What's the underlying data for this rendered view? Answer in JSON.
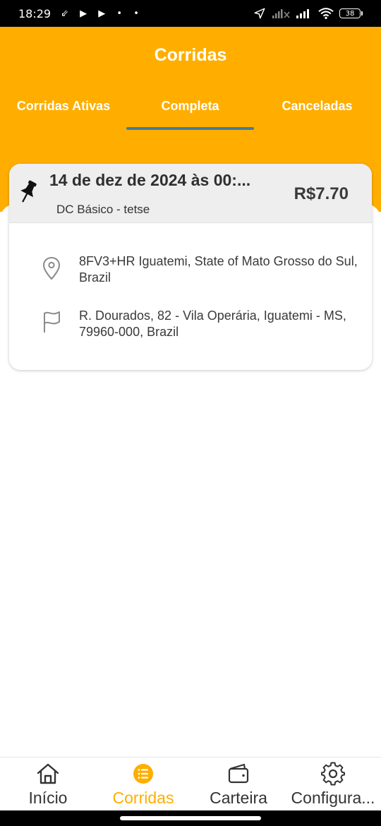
{
  "status_bar": {
    "time": "18:29",
    "left_glyphs": "⇙ ▶ ▶ • •",
    "battery_level": "38"
  },
  "header": {
    "title": "Corridas",
    "background_color": "#FFAE00",
    "tabs": [
      {
        "label": "Corridas Ativas",
        "active": false
      },
      {
        "label": "Completa",
        "active": true
      },
      {
        "label": "Canceladas",
        "active": false
      }
    ],
    "indicator_color": "#3F7DA6"
  },
  "ride": {
    "date": "14 de dez de 2024 às 00:...",
    "service": "DC Básico - tetse",
    "price": "R$7.70",
    "icon": "pushpin-icon",
    "pickup_icon": "location-pin-icon",
    "pickup_address": "8FV3+HR Iguatemi, State of Mato Grosso do Sul, Brazil",
    "dropoff_icon": "flag-icon",
    "dropoff_address": "R. Dourados, 82 - Vila Operária, Iguatemi - MS, 79960-000, Brazil"
  },
  "bottom_nav": {
    "active_color": "#FFAE00",
    "items": [
      {
        "label": "Início",
        "icon": "home-icon",
        "active": false
      },
      {
        "label": "Corridas",
        "icon": "list-icon",
        "active": true
      },
      {
        "label": "Carteira",
        "icon": "wallet-icon",
        "active": false
      },
      {
        "label": "Configura...",
        "icon": "gear-icon",
        "active": false
      }
    ]
  }
}
